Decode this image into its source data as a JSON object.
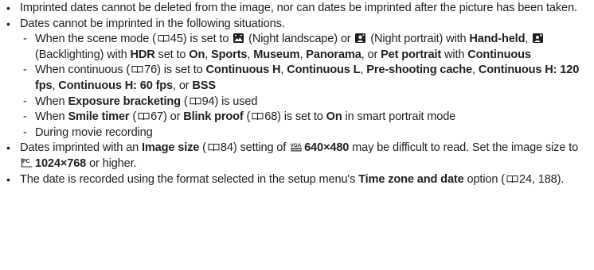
{
  "bullets": {
    "b1": "Imprinted dates cannot be deleted from the image, nor can dates be imprinted after the picture has been taken.",
    "b2": "Dates cannot be imprinted in the following situations.",
    "sub1": {
      "t1": "When the scene mode (",
      "ref1": "45",
      "t2": ") is set to ",
      "t3": " (Night landscape) or ",
      "t4": " (Night portrait) with ",
      "bold1": "Hand-held",
      "t5": ", ",
      "t6": " (Backlighting) with ",
      "bold2": "HDR",
      "t7": " set to ",
      "bold3": "On",
      "t8": ", ",
      "bold4": "Sports",
      "t9": ", ",
      "bold5": "Museum",
      "t10": ", ",
      "bold6": "Panorama",
      "t11": ", or ",
      "bold7": "Pet portrait",
      "t12": " with ",
      "bold8": "Continuous"
    },
    "sub2": {
      "t1": "When continuous (",
      "ref1": "76",
      "t2": ") is set to ",
      "bold1": "Continuous H",
      "t3": ", ",
      "bold2": "Continuous L",
      "t4": ", ",
      "bold3": "Pre-shooting cache",
      "t5": ", ",
      "bold4": "Continuous H: 120 fps",
      "t6": ", ",
      "bold5": "Continuous H: 60 fps",
      "t7": ", or ",
      "bold6": "BSS"
    },
    "sub3": {
      "t1": "When ",
      "bold1": "Exposure bracketing",
      "t2": " (",
      "ref1": "94",
      "t3": ") is used"
    },
    "sub4": {
      "t1": "When ",
      "bold1": "Smile timer",
      "t2": " (",
      "ref1": "67",
      "t3": ") or ",
      "bold2": "Blink proof",
      "t4": " (",
      "ref2": "68",
      "t5": ") is set to ",
      "bold3": "On",
      "t6": " in smart portrait mode"
    },
    "sub5": {
      "t1": "During movie recording"
    },
    "b3": {
      "t1": "Dates imprinted with an ",
      "bold1": "Image size",
      "t2": " (",
      "ref1": "84",
      "t3": ") setting of ",
      "bold2": "640×480",
      "t4": " may be difficult to read. Set the image size to ",
      "bold3": "1024×768",
      "t5": " or higher."
    },
    "b4": {
      "t1": "The date is recorded using the format selected in the setup menu's ",
      "bold1": "Time zone and date",
      "t2": " option (",
      "ref1": "24, 188",
      "t3": ")."
    }
  },
  "icons": {
    "page_ref": "book-reference-icon",
    "night_landscape": "night-landscape-icon",
    "night_portrait": "night-portrait-icon",
    "backlighting": "backlighting-icon",
    "size_640": "image-size-vga-icon",
    "size_1024": "image-size-pc-icon"
  }
}
